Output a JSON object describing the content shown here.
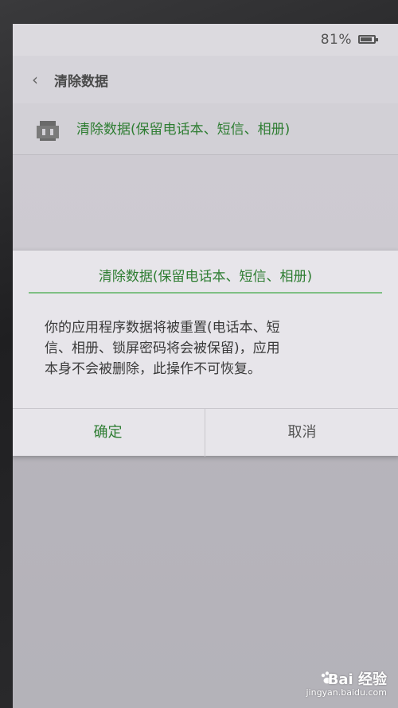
{
  "status_bar": {
    "battery_percent": "81%"
  },
  "header": {
    "title": "清除数据"
  },
  "option": {
    "label": "清除数据(保留电话本、短信、相册)"
  },
  "dialog": {
    "title": "清除数据(保留电话本、短信、相册)",
    "message_line1": "你的应用程序数据将被重置(电话本、短",
    "message_line2": "信、相册、锁屏密码将会被保留)，应用",
    "message_line3": "本身不会被删除，此操作不可恢复。",
    "confirm_label": "确定",
    "cancel_label": "取消"
  },
  "watermark": {
    "brand": "Bai 经验",
    "url": "jingyan.baidu.com"
  },
  "colors": {
    "accent_green": "#2e7d32",
    "divider_green": "#7fbf84"
  }
}
